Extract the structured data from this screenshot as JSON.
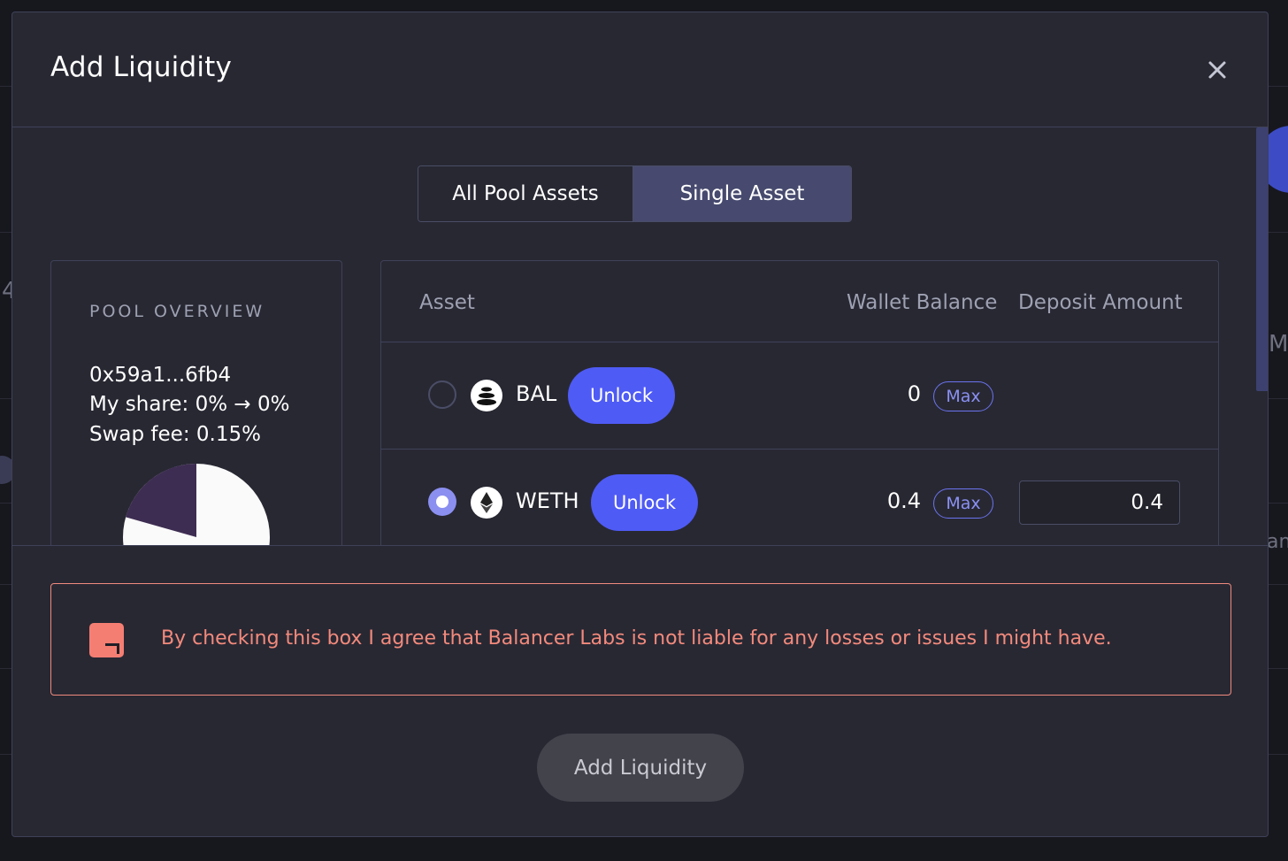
{
  "modal": {
    "title": "Add Liquidity",
    "close_icon": "close-icon"
  },
  "mode_toggle": {
    "options": [
      "All Pool Assets",
      "Single Asset"
    ],
    "selected": "Single Asset"
  },
  "pool_overview": {
    "heading": "POOL OVERVIEW",
    "address": "0x59a1...6fb4",
    "my_share": "My share: 0% → 0%",
    "swap_fee": "Swap fee: 0.15%",
    "pie_colors": [
      "#fafafa",
      "#3e2d52"
    ]
  },
  "asset_table": {
    "headers": {
      "asset": "Asset",
      "wallet_balance": "Wallet Balance",
      "deposit_amount": "Deposit Amount"
    },
    "rows": [
      {
        "symbol": "BAL",
        "icon": "bal-token-icon",
        "selected": false,
        "unlock_label": "Unlock",
        "balance": "0",
        "max_label": "Max",
        "deposit": ""
      },
      {
        "symbol": "WETH",
        "icon": "eth-token-icon",
        "selected": true,
        "unlock_label": "Unlock",
        "balance": "0.4",
        "max_label": "Max",
        "deposit": "0.4"
      }
    ]
  },
  "agreement": {
    "text": "By checking this box I agree that Balancer Labs is not liable for any losses or issues I might have.",
    "accent_color": "#f57e72"
  },
  "submit": {
    "label": "Add Liquidity"
  },
  "background": {
    "fragments": [
      "4",
      "My",
      "an"
    ]
  },
  "colors": {
    "accent": "#4f5bf5",
    "panel": "#282833",
    "border": "#3f4158"
  }
}
